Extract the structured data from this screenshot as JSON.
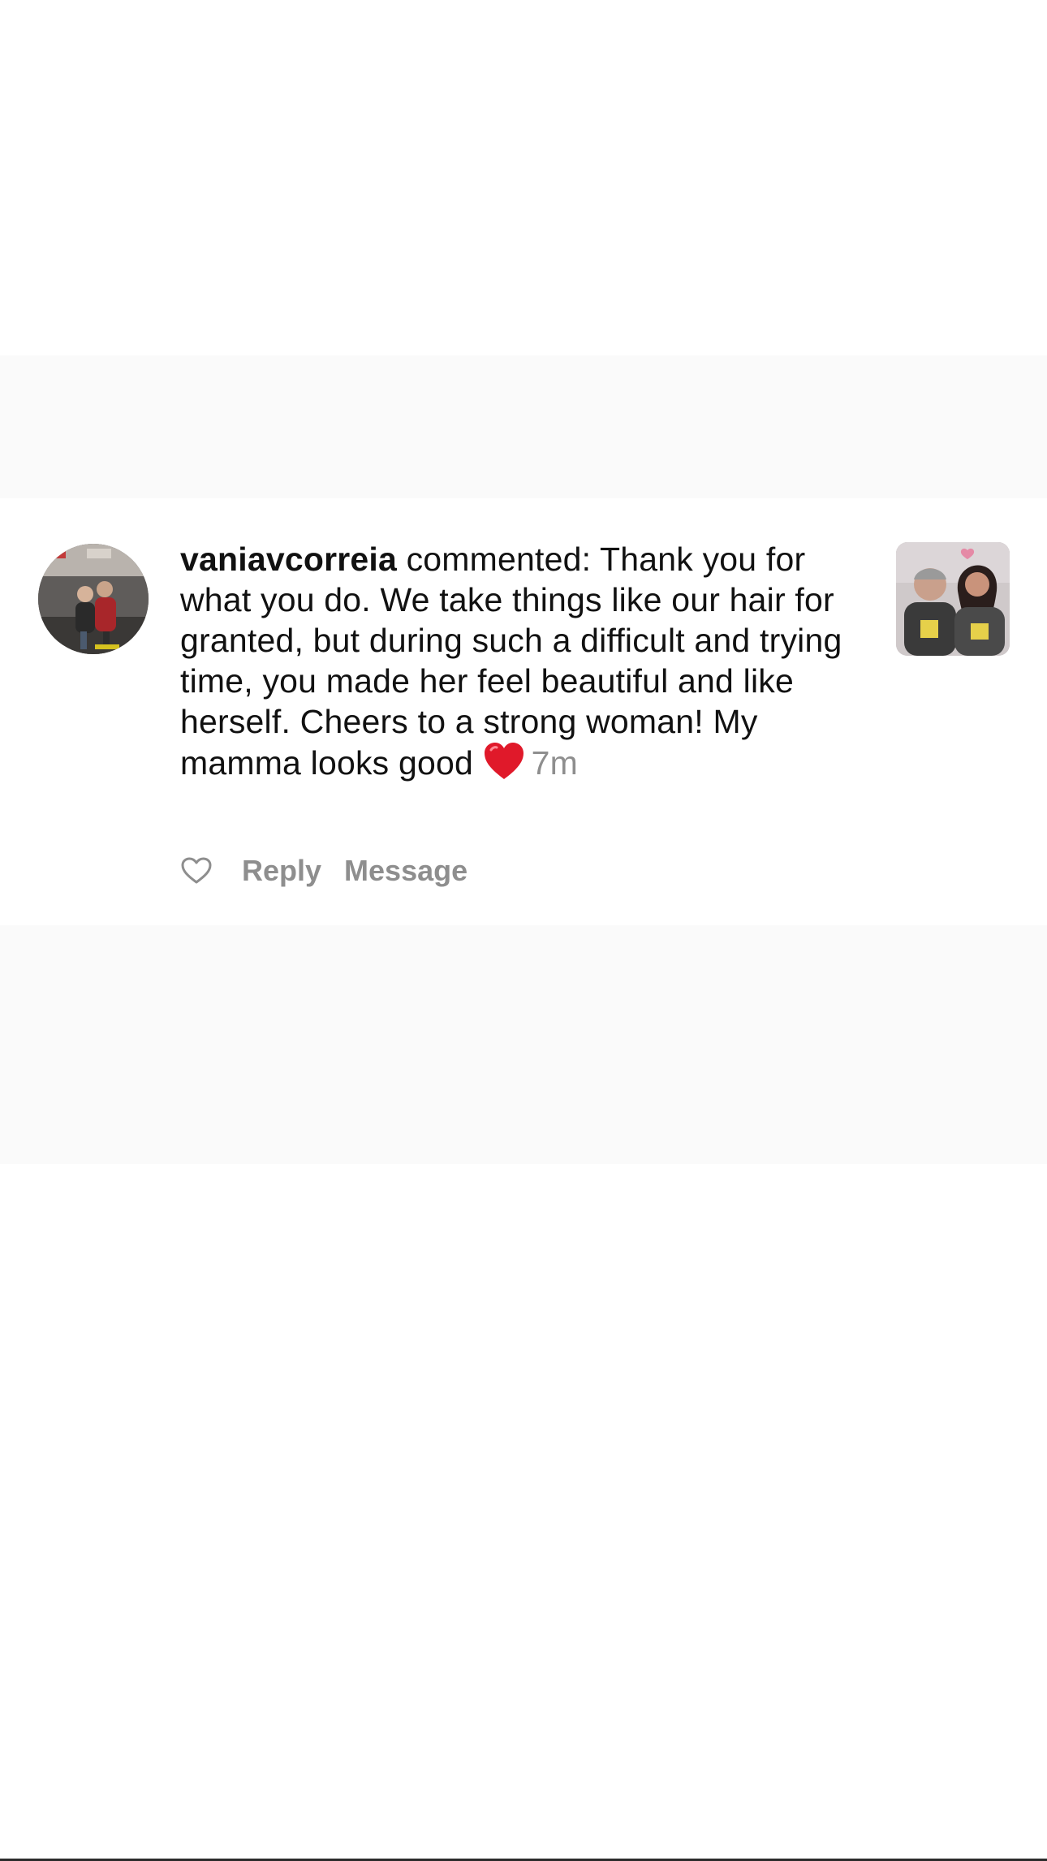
{
  "comment": {
    "username": "vaniavcorreia",
    "text": " commented: Thank you for what you do. We take things like our hair for granted, but during such a difficult and trying time, you made her feel beautiful and like herself. Cheers to a strong woman! My mamma looks good ",
    "time": "7m",
    "emoji": "red-heart-emoji"
  },
  "actions": {
    "like_icon": "heart-outline-icon",
    "reply_label": "Reply",
    "message_label": "Message"
  },
  "colors": {
    "text": "#111111",
    "muted": "#8e8e8e",
    "heart": "#e0192a",
    "band": "#fafafa"
  }
}
